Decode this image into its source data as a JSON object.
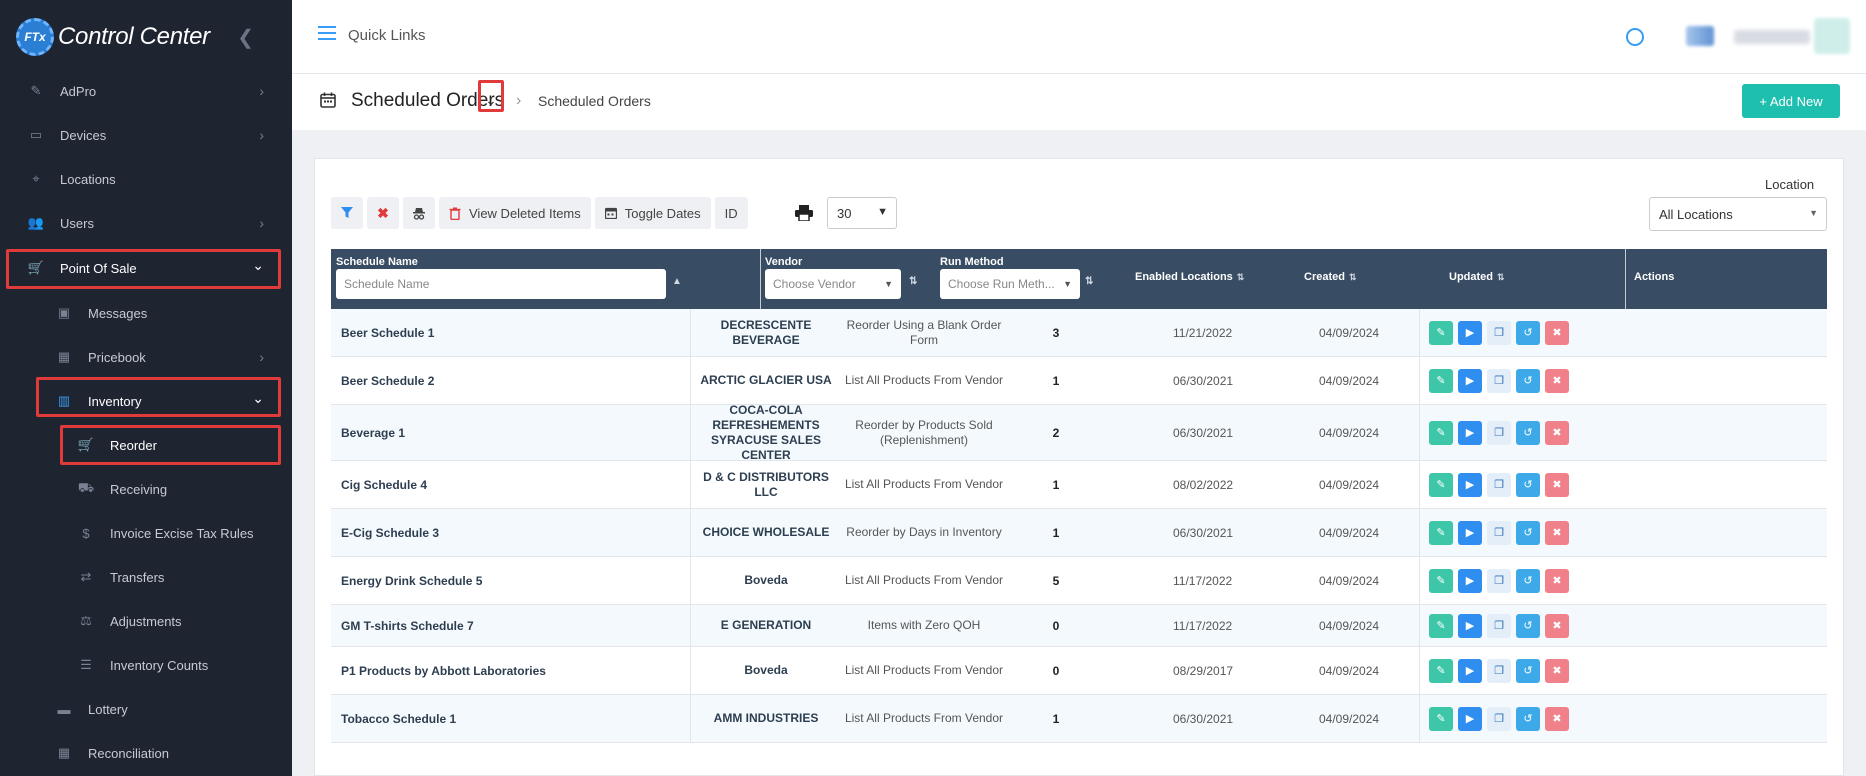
{
  "app": {
    "title": "Control Center",
    "logo_text": "FTx"
  },
  "sidebar": {
    "items": [
      {
        "label": "AdPro",
        "icon": "megaphone-icon",
        "chevron": "›"
      },
      {
        "label": "Devices",
        "icon": "devices-icon",
        "chevron": "›"
      },
      {
        "label": "Locations",
        "icon": "map-pin-icon",
        "chevron": ""
      },
      {
        "label": "Users",
        "icon": "users-icon",
        "chevron": "›"
      },
      {
        "label": "Point Of Sale",
        "icon": "cart-icon",
        "chevron": "⌄"
      },
      {
        "label": "Messages",
        "icon": "messages-icon",
        "chevron": ""
      },
      {
        "label": "Pricebook",
        "icon": "calculator-icon",
        "chevron": "›"
      },
      {
        "label": "Inventory",
        "icon": "inventory-icon",
        "chevron": "⌄"
      },
      {
        "label": "Reorder",
        "icon": "cart-icon",
        "chevron": ""
      },
      {
        "label": "Receiving",
        "icon": "truck-icon",
        "chevron": ""
      },
      {
        "label": "Invoice Excise Tax Rules",
        "icon": "dollar-icon",
        "chevron": ""
      },
      {
        "label": "Transfers",
        "icon": "transfer-icon",
        "chevron": ""
      },
      {
        "label": "Adjustments",
        "icon": "scale-icon",
        "chevron": ""
      },
      {
        "label": "Inventory Counts",
        "icon": "checklist-icon",
        "chevron": ""
      },
      {
        "label": "Lottery",
        "icon": "ticket-icon",
        "chevron": ""
      },
      {
        "label": "Reconciliation",
        "icon": "grid-icon",
        "chevron": ""
      }
    ]
  },
  "topbar": {
    "quick_links": "Quick Links"
  },
  "page": {
    "title": "Scheduled Orders",
    "breadcrumb": "Scheduled Orders",
    "add_new": "+ Add New"
  },
  "toolbar": {
    "view_deleted": "View Deleted Items",
    "toggle_dates": "Toggle Dates",
    "id_label": "ID",
    "page_size": "30",
    "location_label": "Location",
    "location_value": "All Locations"
  },
  "table": {
    "headers": {
      "name": "Schedule Name",
      "vendor": "Vendor",
      "run_method": "Run Method",
      "enabled_locations": "Enabled Locations",
      "created": "Created",
      "updated": "Updated",
      "actions": "Actions"
    },
    "filters": {
      "name_placeholder": "Schedule Name",
      "vendor_placeholder": "Choose Vendor",
      "run_placeholder": "Choose Run Meth..."
    },
    "rows": [
      {
        "name": "Beer Schedule 1",
        "vendor": "DECRESCENTE BEVERAGE",
        "run": "Reorder Using a Blank Order Form",
        "locations": "3",
        "created": "11/21/2022",
        "updated": "04/09/2024"
      },
      {
        "name": "Beer Schedule 2",
        "vendor": "ARCTIC GLACIER USA",
        "run": "List All Products From Vendor",
        "locations": "1",
        "created": "06/30/2021",
        "updated": "04/09/2024"
      },
      {
        "name": "Beverage 1",
        "vendor": "COCA-COLA REFRESHEMENTS SYRACUSE SALES CENTER",
        "run": "Reorder by Products Sold (Replenishment)",
        "locations": "2",
        "created": "06/30/2021",
        "updated": "04/09/2024"
      },
      {
        "name": "Cig Schedule 4",
        "vendor": "D & C DISTRIBUTORS LLC",
        "run": "List All Products From Vendor",
        "locations": "1",
        "created": "08/02/2022",
        "updated": "04/09/2024"
      },
      {
        "name": "E-Cig Schedule 3",
        "vendor": "CHOICE WHOLESALE",
        "run": "Reorder by Days in Inventory",
        "locations": "1",
        "created": "06/30/2021",
        "updated": "04/09/2024"
      },
      {
        "name": "Energy Drink Schedule 5",
        "vendor": "Boveda",
        "run": "List All Products From Vendor",
        "locations": "5",
        "created": "11/17/2022",
        "updated": "04/09/2024"
      },
      {
        "name": "GM T-shirts Schedule 7",
        "vendor": "E GENERATION",
        "run": "Items with Zero QOH",
        "locations": "0",
        "created": "11/17/2022",
        "updated": "04/09/2024"
      },
      {
        "name": "P1 Products by Abbott Laboratories",
        "vendor": "Boveda",
        "run": "List All Products From Vendor",
        "locations": "0",
        "created": "08/29/2017",
        "updated": "04/09/2024"
      },
      {
        "name": "Tobacco Schedule 1",
        "vendor": "AMM INDUSTRIES",
        "run": "List All Products From Vendor",
        "locations": "1",
        "created": "06/30/2021",
        "updated": "04/09/2024"
      }
    ]
  },
  "colors": {
    "sidebar_bg": "#1f2431",
    "accent": "#3b9cf5",
    "add_button": "#1ebfae",
    "table_header": "#384c63",
    "highlight": "#e03a3a"
  }
}
